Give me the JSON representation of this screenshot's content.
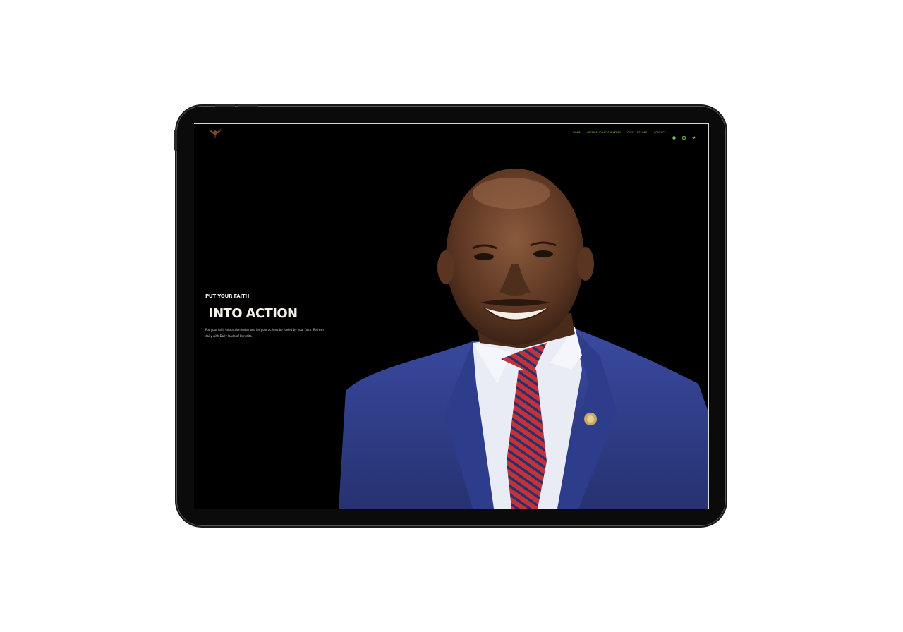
{
  "nav": {
    "links": [
      "Home",
      "Inspirational Speakers",
      "Daily Lessons",
      "Contact"
    ],
    "icons": [
      "whatsapp-icon",
      "instagram-icon",
      "twitter-icon"
    ],
    "accent": "#86d93f"
  },
  "hero": {
    "eyebrow": "PUT YOUR FAITH",
    "headline": "INTO ACTION",
    "lead": "Put your faith into action today and let your actions be fueled by your faith. Refresh daily with Daily loads of Benefits."
  },
  "colors": {
    "background": "#000000",
    "suit": "#2b3a8a",
    "tie_red": "#c2323b"
  }
}
